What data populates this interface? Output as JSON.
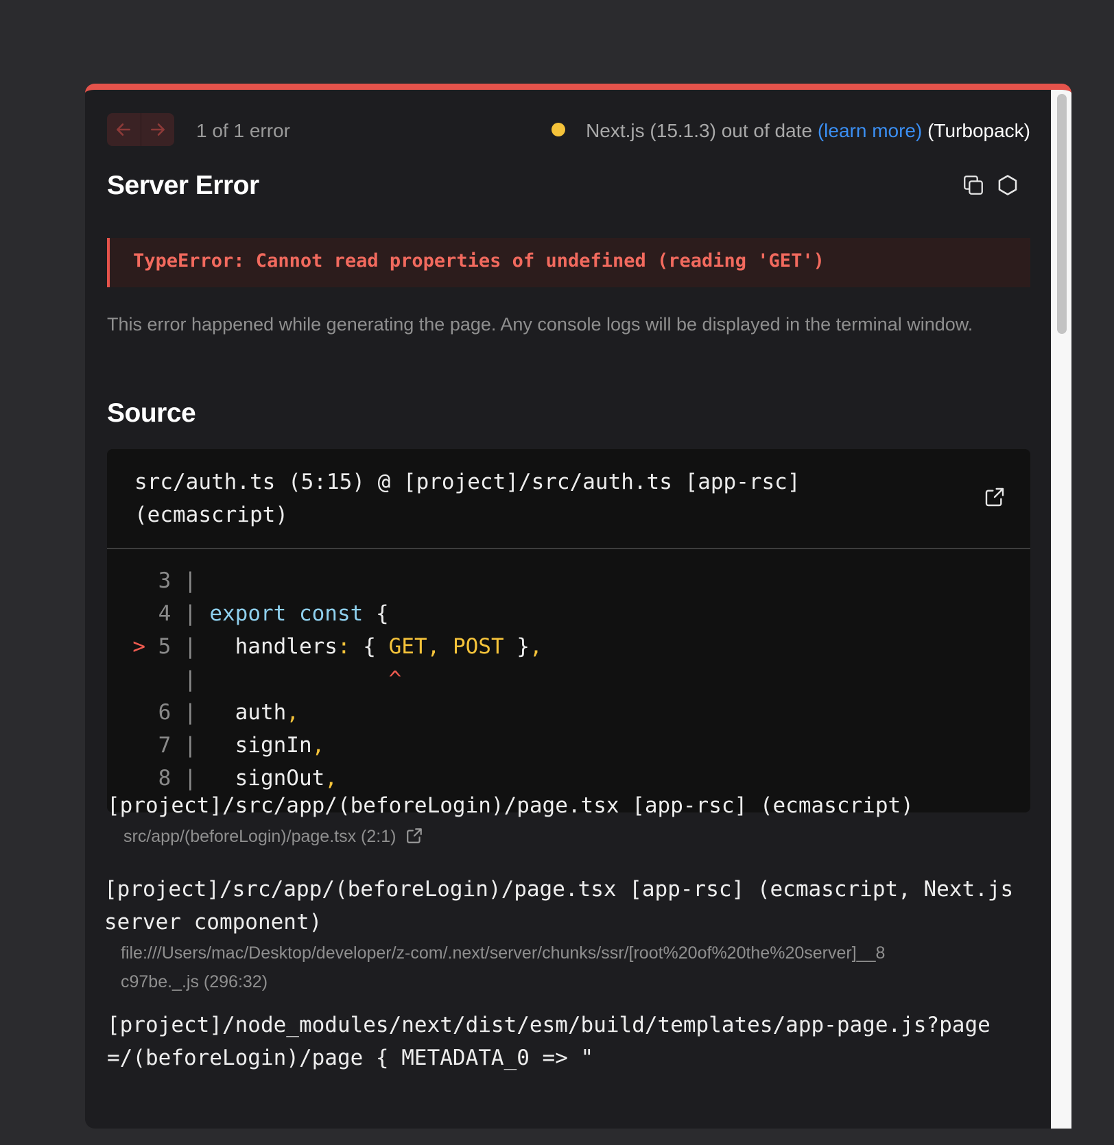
{
  "header": {
    "prev_icon": "arrow-left-icon",
    "next_icon": "arrow-right-icon",
    "error_count": "1 of 1 error",
    "version_text": "Next.js (15.1.3) out of date",
    "learn_more": "(learn more)",
    "bundler": "(Turbopack)",
    "status_color": "#f5c33a"
  },
  "title": "Server Error",
  "error_message": "TypeError: Cannot read properties of undefined (reading 'GET')",
  "hint": "This error happened while generating the page. Any console logs will be displayed in the terminal window.",
  "source": {
    "heading": "Source",
    "file": "src/auth.ts (5:15) @ [project]/src/auth.ts [app-rsc] (ecmascript)",
    "lines": [
      {
        "marker": "  ",
        "num": "3",
        "pipe": " |",
        "code": []
      },
      {
        "marker": "  ",
        "num": "4",
        "pipe": " |",
        "code": [
          {
            "t": " ",
            "c": "pl"
          },
          {
            "t": "export",
            "c": "kw"
          },
          {
            "t": " ",
            "c": "pl"
          },
          {
            "t": "const",
            "c": "kw"
          },
          {
            "t": " {",
            "c": "pl"
          }
        ]
      },
      {
        "marker": "> ",
        "num": "5",
        "pipe": " |",
        "code": [
          {
            "t": "   handlers",
            "c": "pl"
          },
          {
            "t": ":",
            "c": "yl"
          },
          {
            "t": " { ",
            "c": "pl"
          },
          {
            "t": "GET",
            "c": "yl"
          },
          {
            "t": ",",
            "c": "yl"
          },
          {
            "t": " ",
            "c": "pl"
          },
          {
            "t": "POST",
            "c": "yl"
          },
          {
            "t": " }",
            "c": "pl"
          },
          {
            "t": ",",
            "c": "yl"
          }
        ]
      },
      {
        "marker": "  ",
        "num": " ",
        "pipe": " |",
        "code": [
          {
            "t": "               ",
            "c": "pl"
          },
          {
            "t": "^",
            "c": "ref"
          }
        ]
      },
      {
        "marker": "  ",
        "num": "6",
        "pipe": " |",
        "code": [
          {
            "t": "   auth",
            "c": "pl"
          },
          {
            "t": ",",
            "c": "yl"
          }
        ]
      },
      {
        "marker": "  ",
        "num": "7",
        "pipe": " |",
        "code": [
          {
            "t": "   signIn",
            "c": "pl"
          },
          {
            "t": ",",
            "c": "yl"
          }
        ]
      },
      {
        "marker": "  ",
        "num": "8",
        "pipe": " |",
        "code": [
          {
            "t": "   signOut",
            "c": "pl"
          },
          {
            "t": ",",
            "c": "yl"
          }
        ]
      }
    ]
  },
  "frames": [
    {
      "fn": "[project]/src/app/(beforeLogin)/page.tsx [app-rsc] (ecmascript)",
      "loc": "src/app/(beforeLogin)/page.tsx (2:1)",
      "has_link": true
    },
    {
      "fn": "[project]/src/app/(beforeLogin)/page.tsx [app-rsc] (ecmascript, Next.js server component)",
      "loc": "file:///Users/mac/Desktop/developer/z-com/.next/server/chunks/ssr/[root%20of%20the%20server]__8c97be._.js (296:32)",
      "has_link": false
    },
    {
      "fn": "[project]/node_modules/next/dist/esm/build/templates/app-page.js?page=/(beforeLogin)/page { METADATA_0 => \"",
      "loc": "",
      "has_link": false
    }
  ],
  "colors": {
    "accent_red": "#e5534b",
    "link_blue": "#3b8ff3",
    "keyword": "#8fd0ee",
    "punct": "#f5c33a"
  }
}
